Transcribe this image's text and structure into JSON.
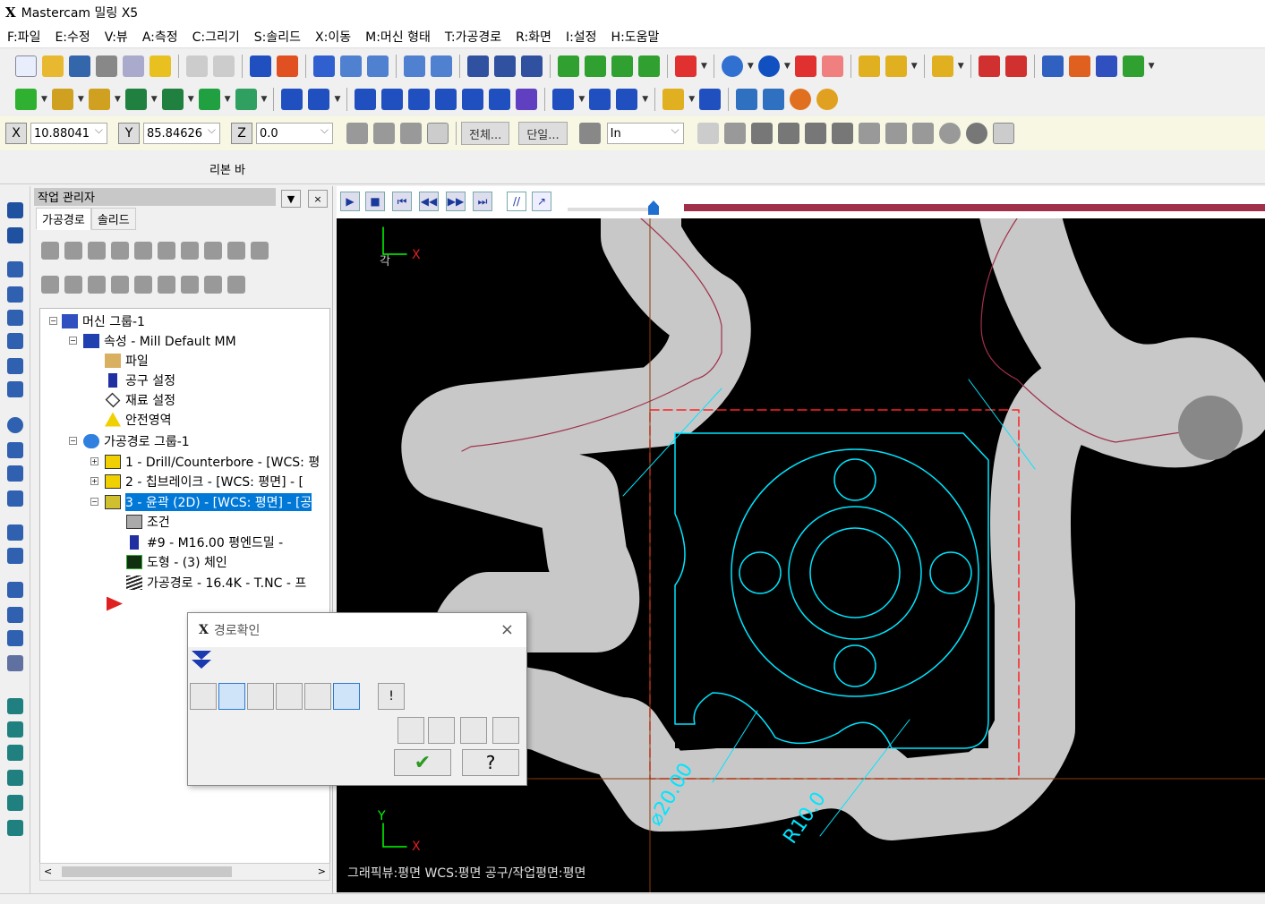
{
  "app": {
    "title": "Mastercam 밀링 X5",
    "logo": "X"
  },
  "menu": [
    "F:파일",
    "E:수정",
    "V:뷰",
    "A:측정",
    "C:그리기",
    "S:솔리드",
    "X:이동",
    "M:머신 형태",
    "T:가공경로",
    "R:화면",
    "I:설정",
    "H:도움말"
  ],
  "coords": {
    "x_label": "X",
    "x_value": "10.88041",
    "y_label": "Y",
    "y_value": "85.84626",
    "z_label": "Z",
    "z_value": "0.0",
    "all_btn": "전체...",
    "single_btn": "단일...",
    "units": "In"
  },
  "ribbon_label": "리본 바",
  "ops": {
    "title": "작업 관리자",
    "close": "×",
    "tabs": [
      "가공경로",
      "솔리드"
    ],
    "tree": [
      {
        "label": "머신 그룹-1"
      },
      {
        "label": "속성 - Mill Default MM"
      },
      {
        "label": "파일"
      },
      {
        "label": "공구 설정"
      },
      {
        "label": "재료 설정"
      },
      {
        "label": "안전영역"
      },
      {
        "label": "가공경로 그룹-1"
      },
      {
        "label": "1 - Drill/Counterbore - [WCS: 평"
      },
      {
        "label": "2 - 칩브레이크 - [WCS: 평면] - ["
      },
      {
        "label": "3 - 윤곽 (2D) - [WCS: 평면] - [공"
      },
      {
        "label": "조건"
      },
      {
        "label": "#9 - M16.00 평엔드밀 -"
      },
      {
        "label": "도형 - (3) 체인"
      },
      {
        "label": "가공경로 - 16.4K - T.NC - 프"
      }
    ]
  },
  "dialog": {
    "title": "경로확인",
    "close": "×"
  },
  "viewport": {
    "status": "그래픽뷰:평면   WCS:평면   공구/작업평면:평면",
    "axis_x": "X",
    "axis_y": "Y",
    "axis_label": "각",
    "dim1": "⌀20.00",
    "dim2": "R10.0"
  },
  "colors": {
    "accent": "#0078d7",
    "toolpath": "#c8c8c8",
    "geometry": "#00e5ff",
    "boundary": "#ff2020",
    "path": "#a0304a"
  }
}
